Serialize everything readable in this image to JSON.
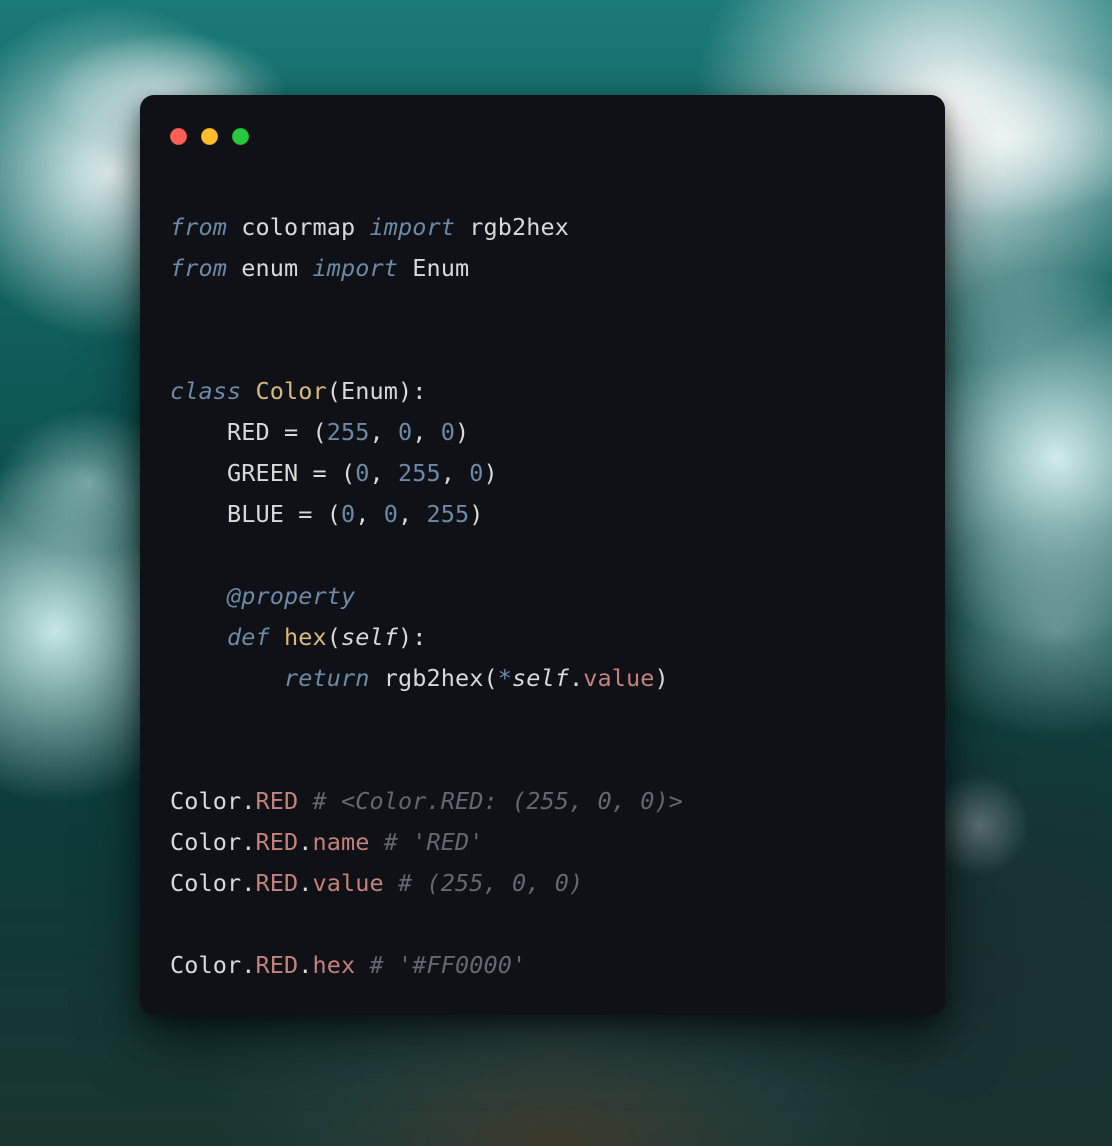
{
  "window": {
    "controls": {
      "close": "close",
      "minimize": "minimize",
      "zoom": "zoom"
    }
  },
  "syntax": {
    "keywords": {
      "from": "from",
      "import_": "import",
      "class_": "class",
      "def_": "def",
      "return_": "return"
    },
    "modules": {
      "colormap": "colormap",
      "enum": "enum"
    },
    "names": {
      "rgb2hex": "rgb2hex",
      "Enum": "Enum",
      "Color": "Color",
      "hex": "hex"
    },
    "members": {
      "RED": "RED",
      "GREEN": "GREEN",
      "BLUE": "BLUE"
    },
    "attrs": {
      "name": "name",
      "value": "value",
      "hex": "hex"
    },
    "decorator": "@property",
    "self": "self"
  },
  "values": {
    "RED": {
      "r": "255",
      "g": "0",
      "b": "0"
    },
    "GREEN": {
      "r": "0",
      "g": "255",
      "b": "0"
    },
    "BLUE": {
      "r": "0",
      "g": "0",
      "b": "255"
    }
  },
  "comments": {
    "repr": "# <Color.RED: (255, 0, 0)>",
    "name": "# 'RED'",
    "value": "# (255, 0, 0)",
    "hex": "# '#FF0000'"
  }
}
